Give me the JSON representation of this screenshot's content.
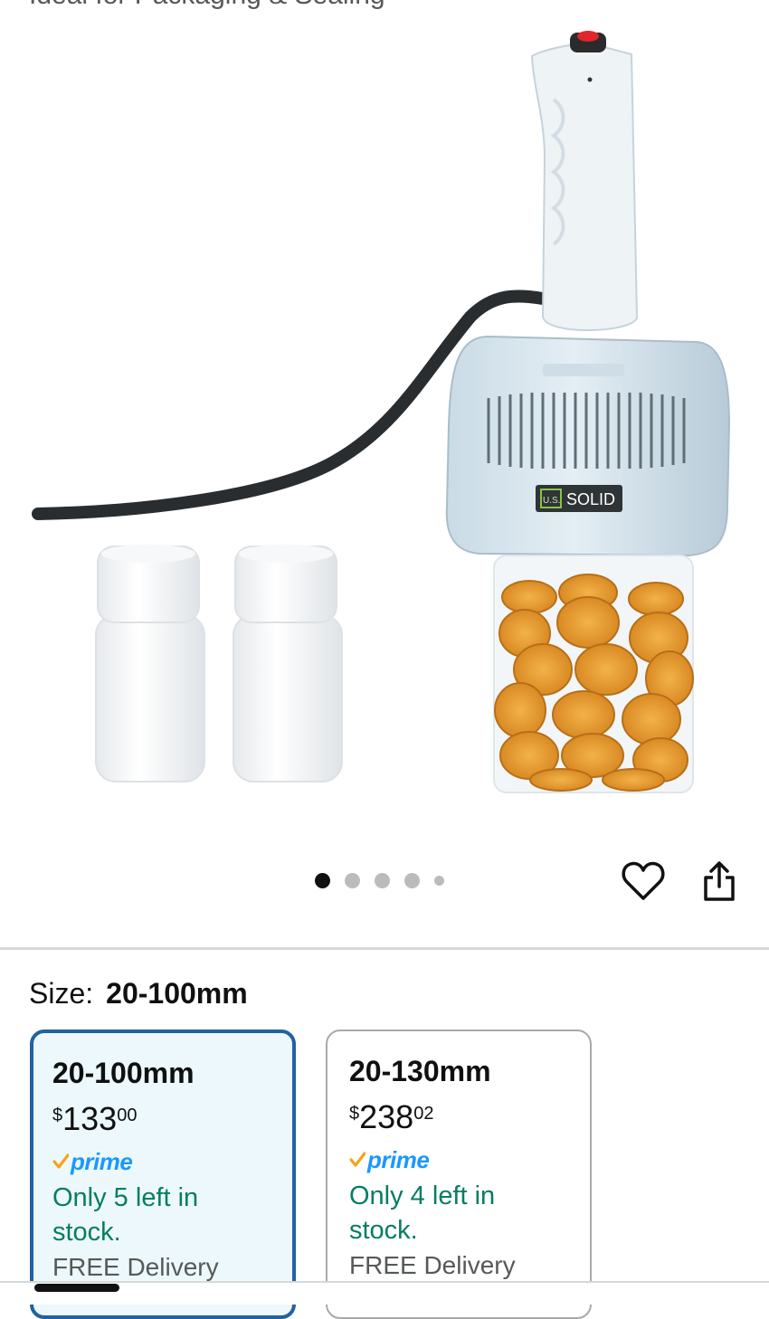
{
  "header": {
    "subtitle_cut": "Ideal for Packaging & Sealing"
  },
  "product_image": {
    "brand_logo_text": "SOLID",
    "brand_logo_prefix": "U.S.",
    "carousel": {
      "total_dots": 5,
      "active_index": 0
    }
  },
  "actions": {
    "favorite_icon": "heart-icon",
    "share_icon": "share-icon"
  },
  "size_selector": {
    "label": "Size:",
    "selected_value": "20-100mm",
    "options": [
      {
        "name": "20-100mm",
        "currency": "$",
        "price_whole": "133",
        "price_fraction": "00",
        "prime": "prime",
        "stock": "Only 5 left in stock.",
        "delivery": "FREE Delivery",
        "selected": true
      },
      {
        "name": "20-130mm",
        "currency": "$",
        "price_whole": "238",
        "price_fraction": "02",
        "prime": "prime",
        "stock": "Only 4 left in stock.",
        "delivery": "FREE Delivery",
        "selected": false
      }
    ]
  },
  "colors": {
    "selected_border": "#2162a1",
    "selected_bg": "#edf8fd",
    "stock_green": "#067d62",
    "prime_blue": "#1a98ff",
    "prime_check": "#f7a21b"
  }
}
